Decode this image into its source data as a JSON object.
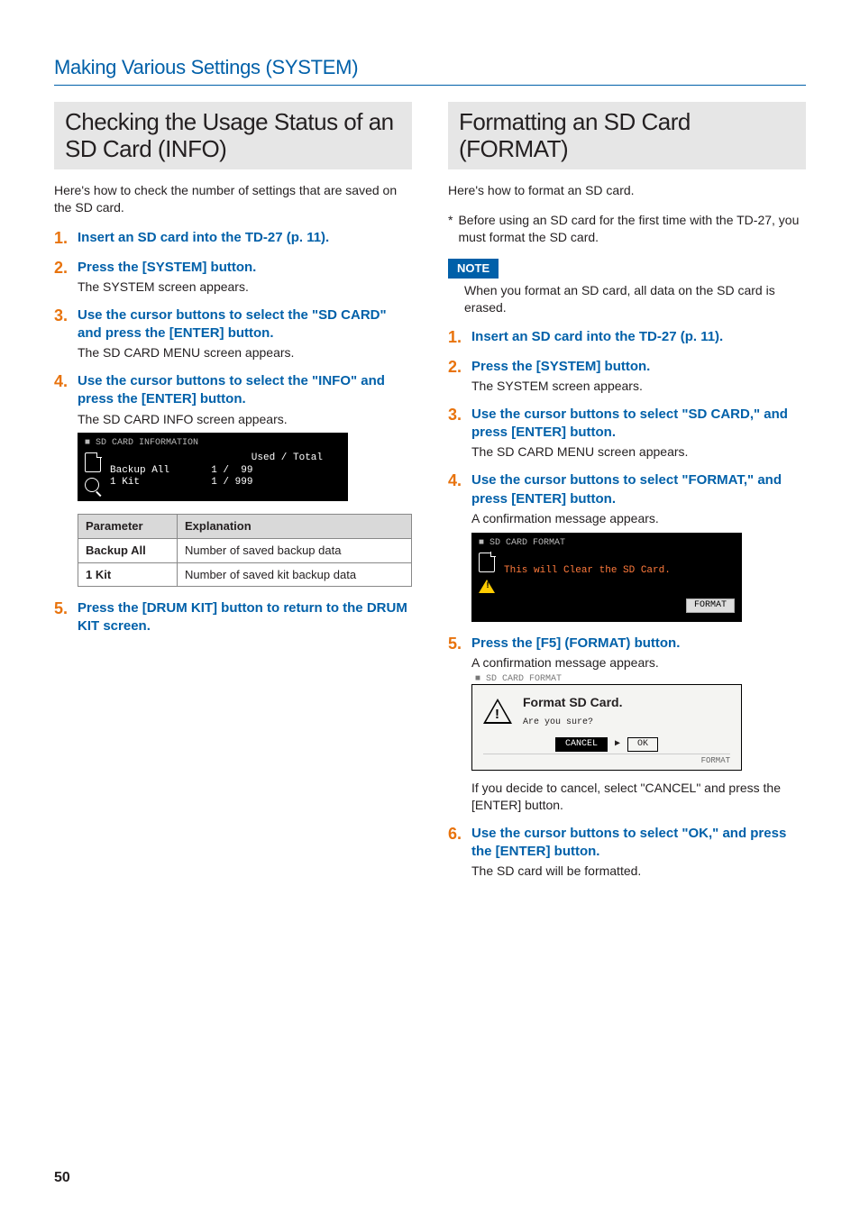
{
  "breadcrumb": "Making Various Settings (SYSTEM)",
  "page_number": "50",
  "left": {
    "title": "Checking the Usage Status of an SD Card (INFO)",
    "intro": "Here's how to check the number of settings that are saved on the SD card.",
    "steps": [
      {
        "head": "Insert an SD card into the TD-27 (p. 11)."
      },
      {
        "head": "Press the [SYSTEM] button.",
        "body": "The SYSTEM screen appears."
      },
      {
        "head": "Use the cursor buttons to select the \"SD CARD\" and press the [ENTER] button.",
        "body": "The SD CARD MENU screen appears."
      },
      {
        "head": "Use the cursor buttons to select the \"INFO\" and press the [ENTER] button.",
        "body": "The SD CARD INFO screen appears."
      },
      {
        "head": "Press the [DRUM KIT] button to return to the DRUM KIT screen."
      }
    ],
    "lcd": {
      "title": "SD CARD INFORMATION",
      "col_header": "Used / Total",
      "rows": [
        {
          "label": "Backup All",
          "value": "1 /  99"
        },
        {
          "label": "1 Kit",
          "value": "1 / 999"
        }
      ]
    },
    "table": {
      "headers": [
        "Parameter",
        "Explanation"
      ],
      "rows": [
        [
          "Backup All",
          "Number of saved backup data"
        ],
        [
          "1 Kit",
          "Number of saved kit backup data"
        ]
      ]
    }
  },
  "right": {
    "title": "Formatting an SD Card (FORMAT)",
    "intro": "Here's how to format an SD card.",
    "star_note": "Before using an SD card for the first time with the TD-27, you must format the SD card.",
    "note_label": "NOTE",
    "note_text": "When you format an SD card, all data on the SD card is erased.",
    "steps": [
      {
        "head": "Insert an SD card into the TD-27 (p. 11)."
      },
      {
        "head": "Press the [SYSTEM] button.",
        "body": "The SYSTEM screen appears."
      },
      {
        "head": "Use the cursor buttons to select \"SD CARD,\" and press [ENTER] button.",
        "body": "The SD CARD MENU screen appears."
      },
      {
        "head": "Use the cursor buttons to select \"FORMAT,\" and press [ENTER] button.",
        "body": "A confirmation message appears."
      },
      {
        "head": "Press the [F5] (FORMAT) button.",
        "body": "A confirmation message appears."
      },
      {
        "head": "Use the cursor buttons to select \"OK,\" and press the [ENTER] button.",
        "body": "The SD card will be formatted."
      }
    ],
    "lcd_format": {
      "title": "SD CARD FORMAT",
      "msg": "This will Clear the SD Card.",
      "button": "FORMAT"
    },
    "lcd_confirm": {
      "pre_title": "SD CARD FORMAT",
      "title": "Format SD Card.",
      "question": "Are you sure?",
      "cancel": "CANCEL",
      "ok": "OK",
      "footer": "FORMAT"
    },
    "after_confirm": "If you decide to cancel, select \"CANCEL\" and press the [ENTER] button."
  }
}
